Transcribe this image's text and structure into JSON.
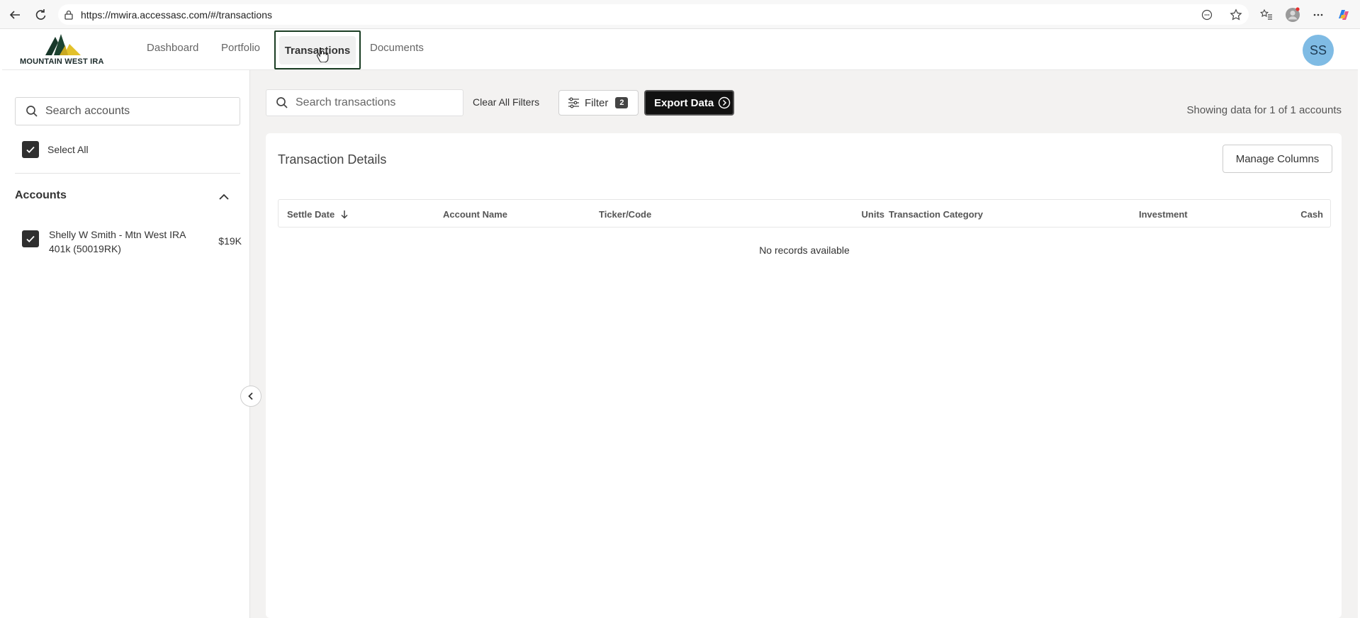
{
  "browser": {
    "url": "https://mwira.accessasc.com/#/transactions"
  },
  "header": {
    "logo_text": "MOUNTAIN WEST IRA",
    "nav": [
      {
        "label": "Dashboard"
      },
      {
        "label": "Portfolio"
      },
      {
        "label": "Transactions",
        "active": true
      },
      {
        "label": "Documents"
      }
    ],
    "avatar_initials": "SS"
  },
  "sidebar": {
    "search_placeholder": "Search accounts",
    "select_all_label": "Select All",
    "accounts_heading": "Accounts",
    "accounts": [
      {
        "name": "Shelly W Smith - Mtn West IRA 401k (50019RK)",
        "value": "$19K",
        "checked": true
      }
    ]
  },
  "toolbar": {
    "search_placeholder": "Search transactions",
    "clear_filters_label": "Clear All Filters",
    "filter_label": "Filter",
    "filter_count": "2",
    "export_label": "Export Data",
    "showing_text": "Showing data for 1 of 1 accounts"
  },
  "table": {
    "title": "Transaction Details",
    "manage_columns_label": "Manage Columns",
    "columns": [
      "Settle Date",
      "Account Name",
      "Ticker/Code",
      "Units",
      "Transaction Category",
      "Investment",
      "Cash"
    ],
    "empty_message": "No records available"
  },
  "colors": {
    "active_nav_border": "#1a3d23",
    "avatar_bg": "#7fbbe4",
    "export_bg": "#111111",
    "checkbox_bg": "#2f2f2f"
  }
}
